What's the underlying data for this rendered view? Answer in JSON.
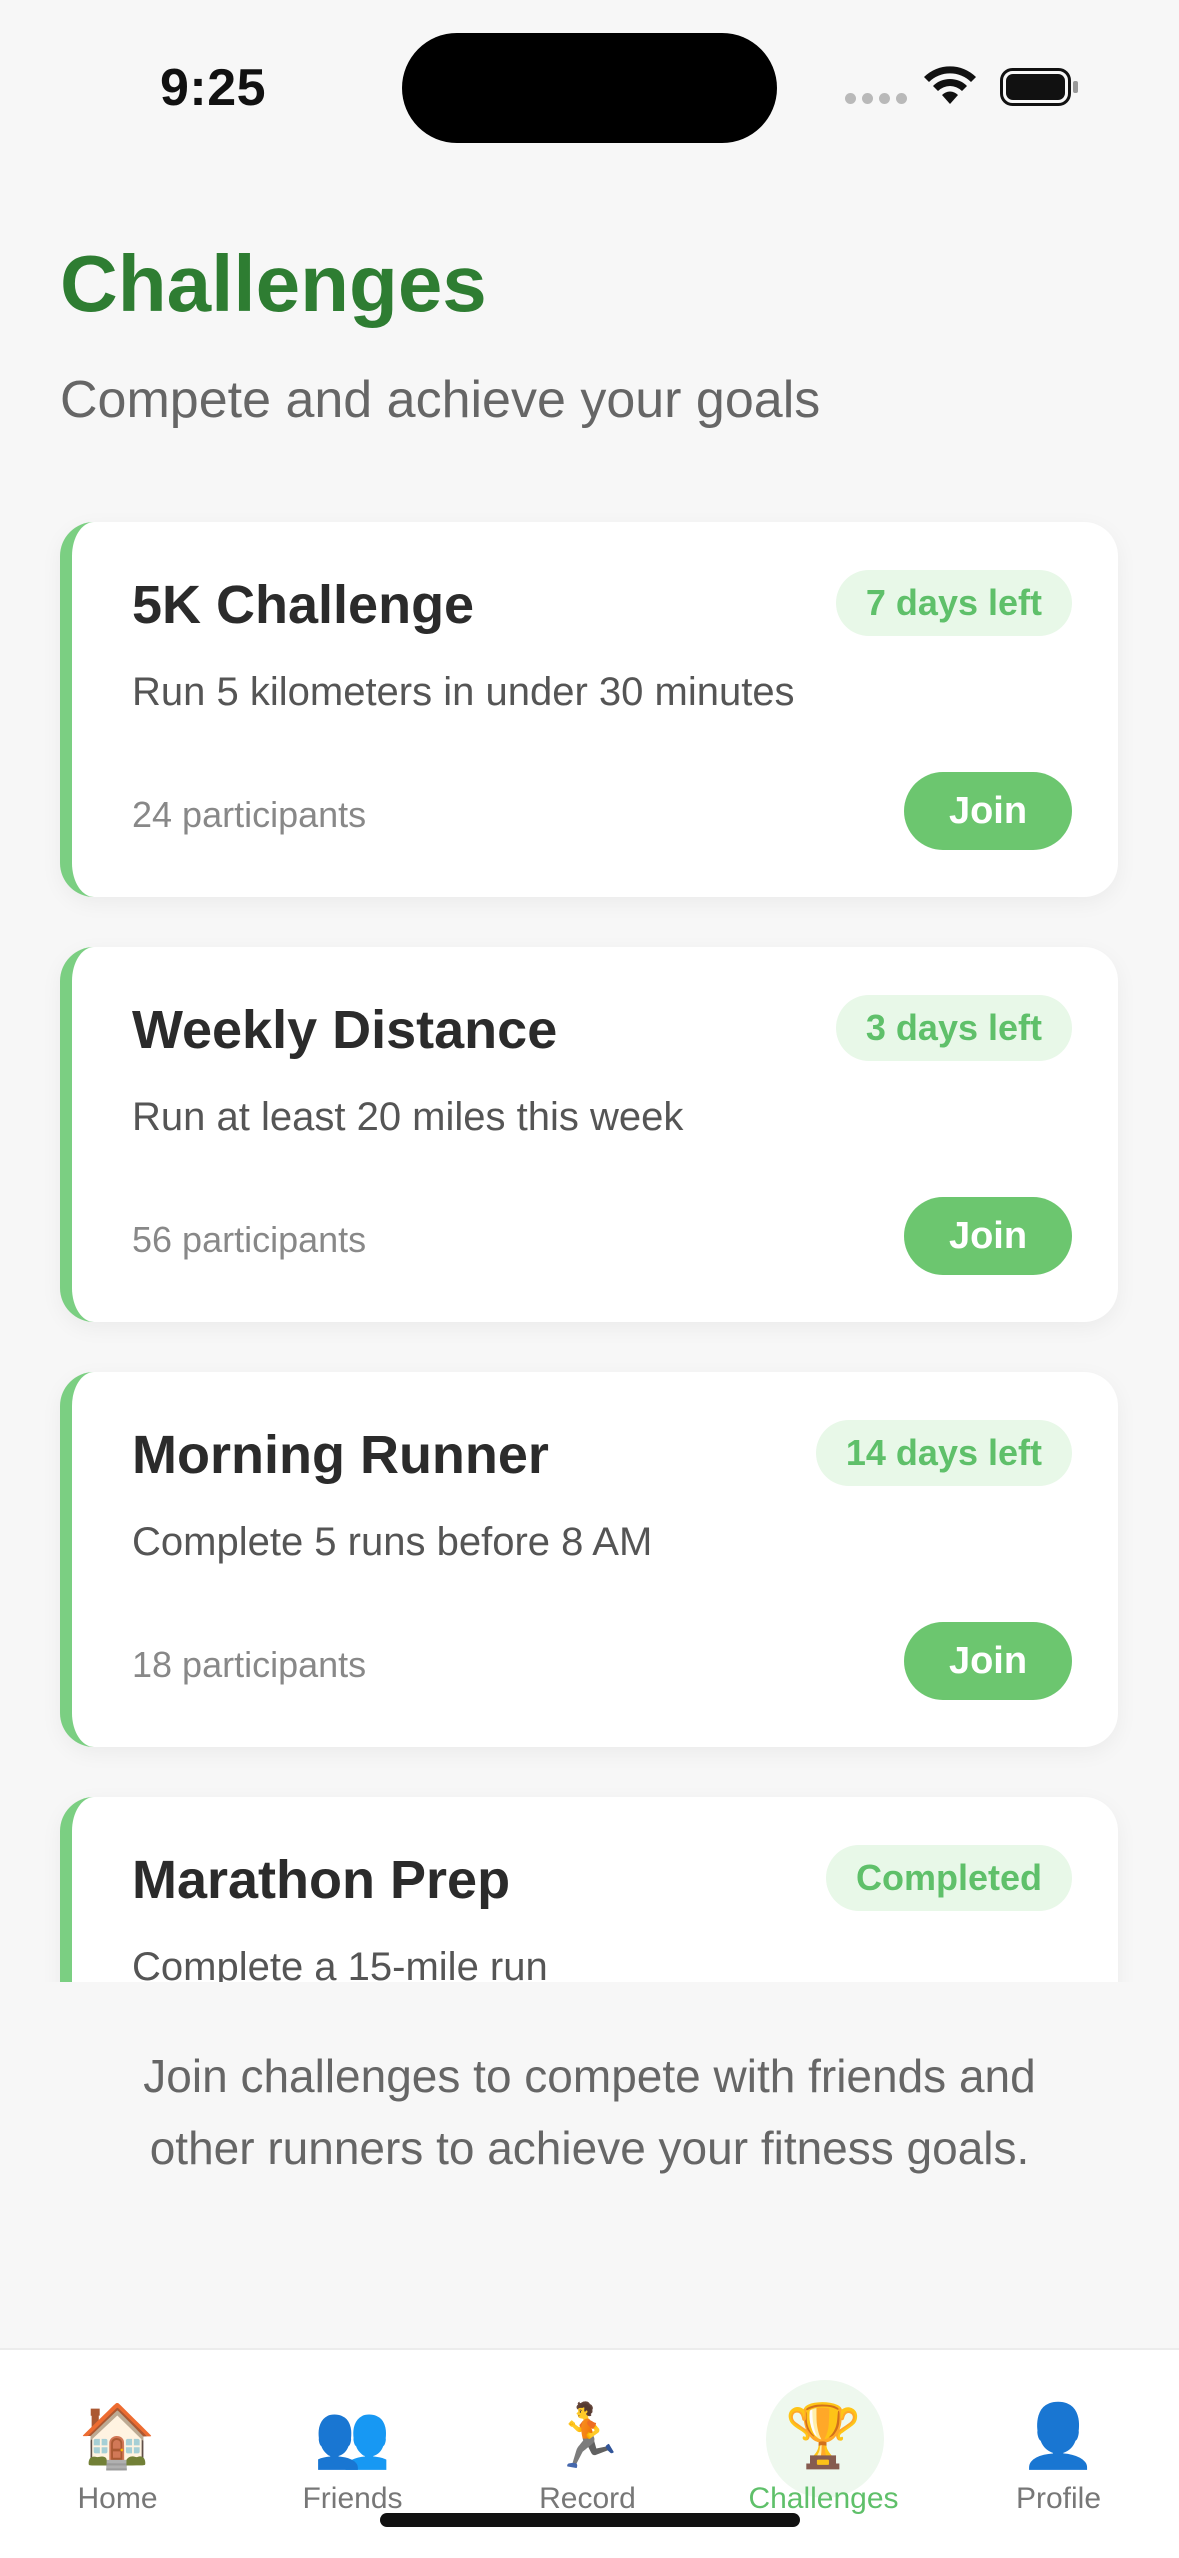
{
  "status_bar": {
    "time": "9:25"
  },
  "header": {
    "title": "Challenges",
    "subtitle": "Compete and achieve your goals"
  },
  "challenges": [
    {
      "title": "5K Challenge",
      "badge": "7 days left",
      "description": "Run 5 kilometers in under 30 minutes",
      "participants": "24 participants",
      "action": "Join"
    },
    {
      "title": "Weekly Distance",
      "badge": "3 days left",
      "description": "Run at least 20 miles this week",
      "participants": "56 participants",
      "action": "Join"
    },
    {
      "title": "Morning Runner",
      "badge": "14 days left",
      "description": "Complete 5 runs before 8 AM",
      "participants": "18 participants",
      "action": "Join"
    },
    {
      "title": "Marathon Prep",
      "badge": "Completed",
      "description": "Complete a 15-mile run"
    }
  ],
  "info_text": "Join challenges to compete with friends and other runners to achieve your fitness goals.",
  "tab_bar": {
    "active": "Challenges",
    "tabs": [
      {
        "label": "Home",
        "icon": "house-icon",
        "glyph": "🏠"
      },
      {
        "label": "Friends",
        "icon": "friends-icon",
        "glyph": "👥"
      },
      {
        "label": "Record",
        "icon": "runner-icon",
        "glyph": "🏃"
      },
      {
        "label": "Challenges",
        "icon": "trophy-icon",
        "glyph": "🏆"
      },
      {
        "label": "Profile",
        "icon": "profile-icon",
        "glyph": "👤"
      }
    ]
  },
  "colors": {
    "title_green": "#2e7d32",
    "accent_green": "#6cc66f",
    "badge_bg": "#e8f8e8",
    "badge_text": "#5fc06a"
  }
}
